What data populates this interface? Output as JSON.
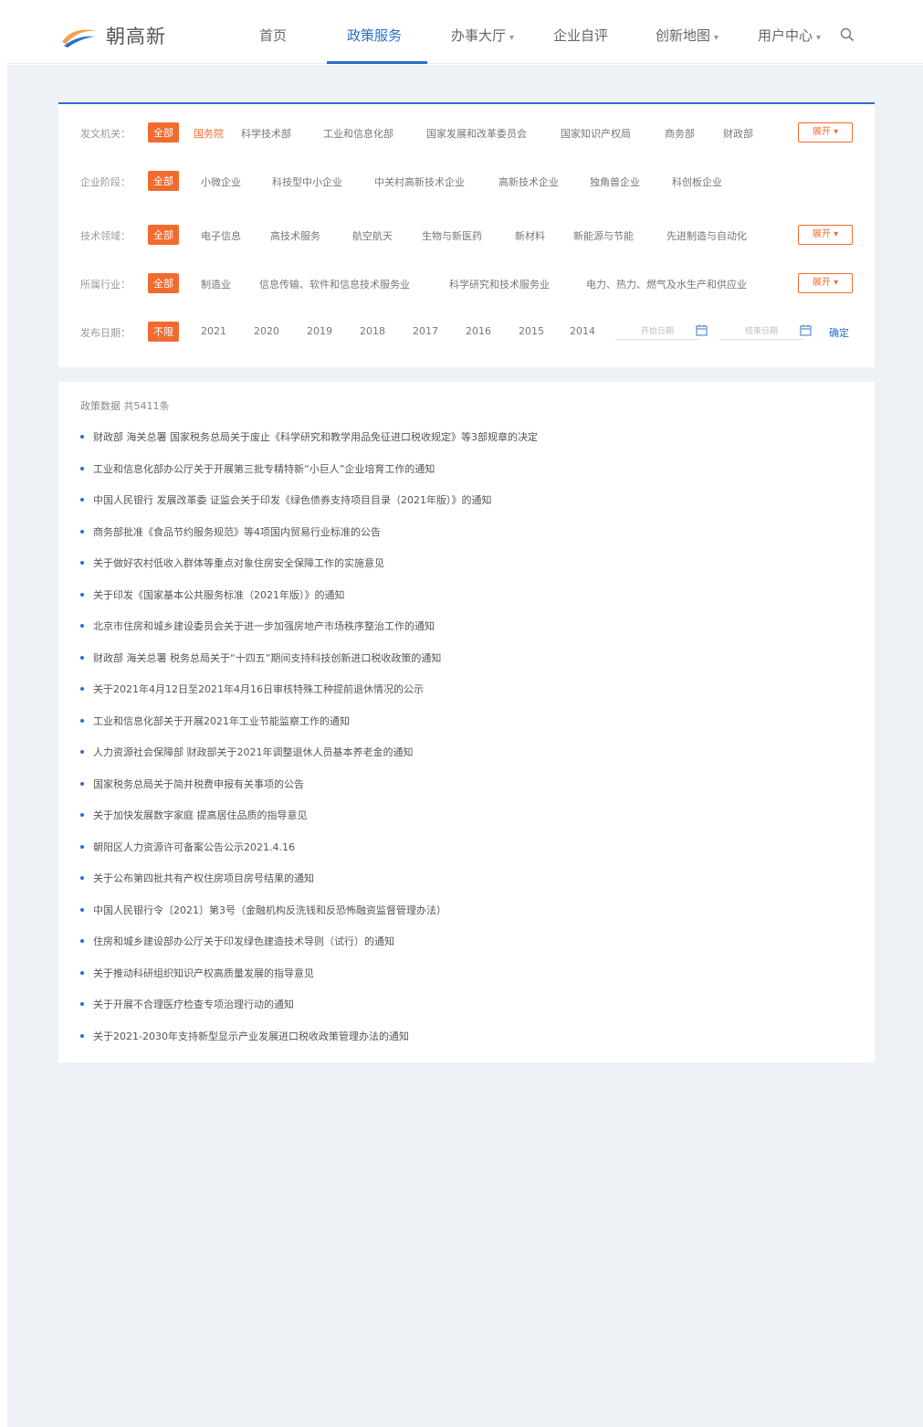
{
  "header": {
    "logo_text": "朝高新",
    "nav": [
      {
        "label": "首页",
        "active": false,
        "caret": false
      },
      {
        "label": "政策服务",
        "active": true,
        "caret": false
      },
      {
        "label": "办事大厅",
        "active": false,
        "caret": true
      },
      {
        "label": "企业自评",
        "active": false,
        "caret": false
      },
      {
        "label": "创新地图",
        "active": false,
        "caret": true
      },
      {
        "label": "用户中心",
        "active": false,
        "caret": true
      }
    ],
    "caret_glyph": "▾",
    "accent_color": "#2a6fc9"
  },
  "filters": {
    "issuing_agency": {
      "label": "发文机关：",
      "options": [
        "全部",
        "国务院",
        "科学技术部",
        "工业和信息化部",
        "国家发展和改革委员会",
        "国家知识产权局",
        "商务部",
        "财政部"
      ],
      "expand": "展开 ▾"
    },
    "enterprise_stage": {
      "label": "企业阶段：",
      "options": [
        "全部",
        "小微企业",
        "科技型中小企业",
        "中关村高新技术企业",
        "高新技术企业",
        "独角兽企业",
        "科创板企业"
      ]
    },
    "tech_field": {
      "label": "技术领域：",
      "options": [
        "全部",
        "电子信息",
        "高技术服务",
        "航空航天",
        "生物与新医药",
        "新材料",
        "新能源与节能",
        "先进制造与自动化"
      ],
      "expand": "展开 ▾"
    },
    "industry": {
      "label": "所属行业：",
      "options": [
        "全部",
        "制造业",
        "信息传输、软件和信息技术服务业",
        "科学研究和技术服务业",
        "电力、热力、燃气及水生产和供应业"
      ],
      "expand": "展开 ▾"
    },
    "publish_date": {
      "label": "发布日期：",
      "options": [
        "不限",
        "2021",
        "2020",
        "2019",
        "2018",
        "2017",
        "2016",
        "2015",
        "2014"
      ],
      "start_placeholder": "开始日期",
      "end_placeholder": "结束日期",
      "confirm": "确定"
    },
    "selected_color": "#f26b2e"
  },
  "results": {
    "count_text": "政策数据 共5411条",
    "items": [
      "财政部 海关总署 国家税务总局关于废止《科学研究和教学用品免征进口税收规定》等3部规章的决定",
      "工业和信息化部办公厅关于开展第三批专精特新“小巨人”企业培育工作的通知",
      "中国人民银行 发展改革委 证监会关于印发《绿色债券支持项目目录（2021年版）》的通知",
      "商务部批准《食品节约服务规范》等4项国内贸易行业标准的公告",
      "关于做好农村低收入群体等重点对象住房安全保障工作的实施意见",
      "关于印发《国家基本公共服务标准（2021年版）》的通知",
      "北京市住房和城乡建设委员会关于进一步加强房地产市场秩序整治工作的通知",
      "财政部 海关总署 税务总局关于“十四五”期间支持科技创新进口税收政策的通知",
      "关于2021年4月12日至2021年4月16日审核特殊工种提前退休情况的公示",
      "工业和信息化部关于开展2021年工业节能监察工作的通知",
      "人力资源社会保障部 财政部关于2021年调整退休人员基本养老金的通知",
      "国家税务总局关于简并税费申报有关事项的公告",
      "关于加快发展数字家庭 提高居住品质的指导意见",
      "朝阳区人力资源许可备案公告公示2021.4.16",
      "关于公布第四批共有产权住房项目房号结果的通知",
      "中国人民银行令〔2021〕第3号（金融机构反洗钱和反恐怖融资监督管理办法）",
      "住房和城乡建设部办公厅关于印发绿色建造技术导则（试行）的通知",
      "关于推动科研组织知识产权高质量发展的指导意见",
      "关于开展不合理医疗检查专项治理行动的通知",
      "关于2021-2030年支持新型显示产业发展进口税收政策管理办法的通知"
    ]
  }
}
